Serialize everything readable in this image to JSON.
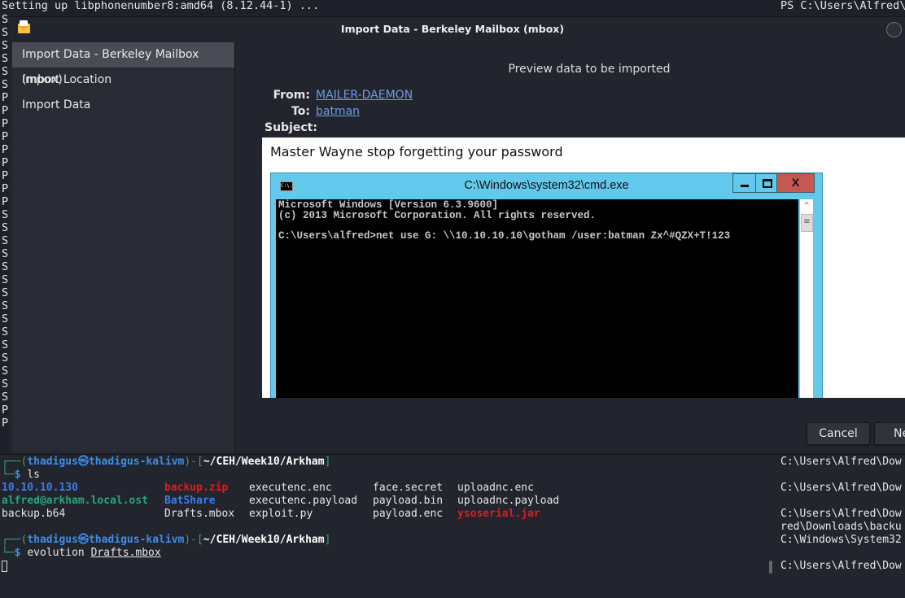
{
  "background_terminal": {
    "top_line": "Setting up libphonenumber8:amd64 (8.12.44-1) ...",
    "right_top_line": "PS C:\\Users\\Alfred\\",
    "side_letters": [
      "S",
      "S",
      "S",
      "S",
      "S",
      "S",
      "P",
      "P",
      "P",
      "P",
      "P",
      "P",
      "P",
      "P",
      "P",
      "S",
      "S",
      "S",
      "S",
      "S",
      "S",
      "S",
      "S",
      "S",
      "S",
      "S",
      "S",
      "S",
      "S",
      "S",
      "P",
      "P"
    ]
  },
  "dialog": {
    "title": "Import Data - Berkeley Mailbox (mbox)",
    "sidebar": {
      "items": [
        {
          "label": "Import Data - Berkeley Mailbox (mbox)",
          "active": true
        },
        {
          "label": "Import Location",
          "active": false
        },
        {
          "label": "Import Data",
          "active": false
        }
      ]
    },
    "preview_title": "Preview data to be imported",
    "headers": {
      "from_label": "From:",
      "from_value": "MAILER-DAEMON",
      "to_label": "To:",
      "to_value": "batman",
      "subject_label": "Subject:"
    },
    "body": {
      "text": "Master Wayne stop forgetting your password",
      "cmd_window": {
        "title": "C:\\Windows\\system32\\cmd.exe",
        "icon_text": "C:\\.",
        "close_label": "X",
        "lines": [
          "Microsoft Windows [Version 6.3.9600]",
          "(c) 2013 Microsoft Corporation. All rights reserved.",
          "",
          "C:\\Users\\alfred>net use G: \\\\10.10.10.10\\gotham /user:batman Zx^#QZX+T!123"
        ]
      }
    },
    "buttons": {
      "cancel": "Cancel",
      "next": "Next"
    }
  },
  "terminal": {
    "prompt1": {
      "user": "thadigus",
      "host": "thadigus-kalivm",
      "path": "~/CEH/Week10/Arkham",
      "command": "ls"
    },
    "ls_output": [
      [
        {
          "name": "10.10.10.130",
          "type": "dir"
        },
        {
          "name": "backup.zip",
          "type": "archive"
        },
        {
          "name": "executenc.enc",
          "type": "file"
        },
        {
          "name": "face.secret",
          "type": "file"
        },
        {
          "name": "uploadnc.enc",
          "type": "file"
        }
      ],
      [
        {
          "name": "alfred@arkham.local.ost",
          "type": "special"
        },
        {
          "name": "BatShare",
          "type": "dir"
        },
        {
          "name": "executenc.payload",
          "type": "file"
        },
        {
          "name": "payload.bin",
          "type": "file"
        },
        {
          "name": "uploadnc.payload",
          "type": "file"
        }
      ],
      [
        {
          "name": "backup.b64",
          "type": "file"
        },
        {
          "name": "Drafts.mbox",
          "type": "file"
        },
        {
          "name": "exploit.py",
          "type": "file"
        },
        {
          "name": "payload.enc",
          "type": "file"
        },
        {
          "name": "ysoserial.jar",
          "type": "archive"
        }
      ]
    ],
    "prompt2": {
      "user": "thadigus",
      "host": "thadigus-kalivm",
      "path": "~/CEH/Week10/Arkham",
      "command": "evolution",
      "arg": "Drafts.mbox"
    },
    "right_column": [
      "C:\\Users\\Alfred\\Dow",
      "",
      "C:\\Users\\Alfred\\Dow",
      "",
      "C:\\Users\\Alfred\\Dow",
      "red\\Downloads\\backu",
      "C:\\Windows\\System32",
      "",
      "C:\\Users\\Alfred\\Dow"
    ]
  }
}
